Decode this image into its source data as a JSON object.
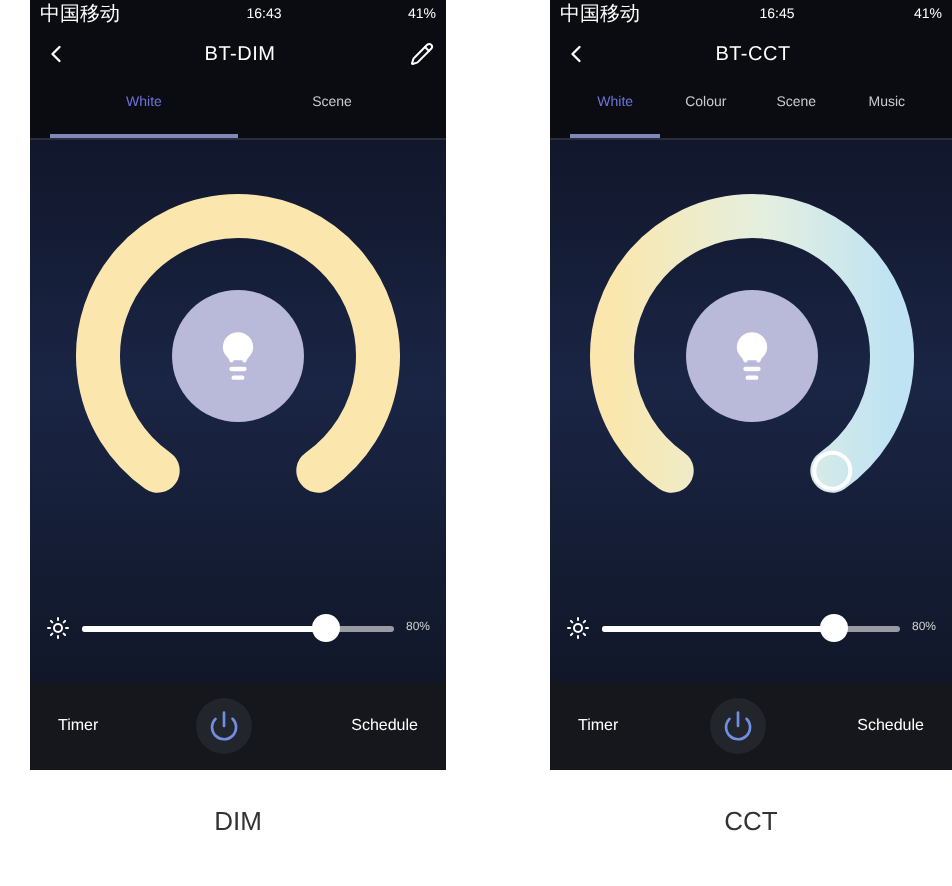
{
  "screens": [
    {
      "caption": "DIM",
      "status_bar": {
        "carrier": "中国移动",
        "time": "16:43",
        "battery": "41%"
      },
      "title": "BT-DIM",
      "edit_button": true,
      "tabs": [
        {
          "label": "White",
          "selected": true
        },
        {
          "label": "Scene",
          "selected": false
        }
      ],
      "dial": {
        "kind": "dim"
      },
      "brightness": {
        "level": 0.78,
        "reading": "80%"
      },
      "bottom_bar": {
        "left": "Timer",
        "right": "Schedule"
      }
    },
    {
      "caption": "CCT",
      "status_bar": {
        "carrier": "中国移动",
        "time": "16:45",
        "battery": "41%"
      },
      "title": "BT-CCT",
      "edit_button": false,
      "tabs": [
        {
          "label": "White",
          "selected": true
        },
        {
          "label": "Colour",
          "selected": false
        },
        {
          "label": "Scene",
          "selected": false
        },
        {
          "label": "Music",
          "selected": false
        }
      ],
      "dial": {
        "kind": "cct"
      },
      "brightness": {
        "level": 0.78,
        "reading": "80%"
      },
      "bottom_bar": {
        "left": "Timer",
        "right": "Schedule"
      }
    }
  ]
}
